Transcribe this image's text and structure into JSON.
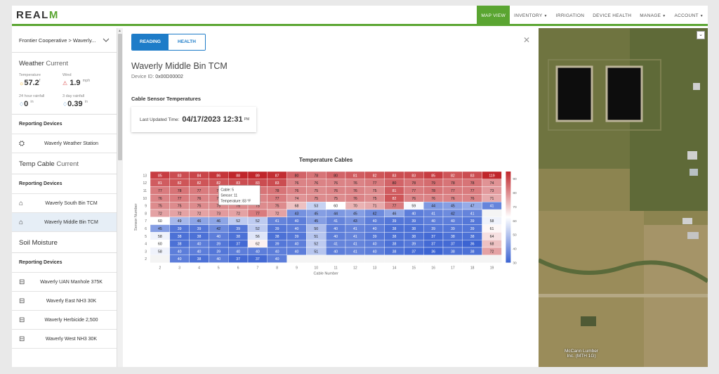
{
  "brand": {
    "logo_main": "REAL",
    "logo_accent": "M"
  },
  "nav": [
    {
      "label": "MAP VIEW",
      "active": true,
      "caret": false
    },
    {
      "label": "INVENTORY",
      "active": false,
      "caret": true
    },
    {
      "label": "IRRIGATION",
      "active": false,
      "caret": false
    },
    {
      "label": "DEVICE HEALTH",
      "active": false,
      "caret": false
    },
    {
      "label": "MANAGE",
      "active": false,
      "caret": true
    },
    {
      "label": "ACCOUNT",
      "active": false,
      "caret": true
    }
  ],
  "sidebar": {
    "breadcrumb": "Frontier Cooperative > Waverly...",
    "weather": {
      "title": "Weather",
      "title_suffix": "Current",
      "temperature_label": "Temperature",
      "temperature_value": "57.2",
      "temperature_unit": "f",
      "wind_label": "Wind",
      "wind_value": "1.9",
      "wind_unit": "mph",
      "rain24_label": "24 hour rainfall",
      "rain24_value": "0",
      "rain24_unit": "in",
      "rain3d_label": "3 day rainfall",
      "rain3d_value": "0.39",
      "rain3d_unit": "in"
    },
    "reporting_label_1": "Reporting Devices",
    "weather_devices": [
      {
        "label": "Waverly Weather Station"
      }
    ],
    "tempcable": {
      "title": "Temp Cable",
      "title_suffix": "Current"
    },
    "reporting_label_2": "Reporting Devices",
    "tc_devices": [
      {
        "label": "Waverly South Bin TCM",
        "selected": false
      },
      {
        "label": "Waverly Middle Bin TCM",
        "selected": true
      }
    ],
    "soil": {
      "title": "Soil Moisture"
    },
    "reporting_label_3": "Reporting Devices",
    "soil_devices": [
      {
        "label": "Waverly UAN Manhole 375K"
      },
      {
        "label": "Waverly East NH3 30K"
      },
      {
        "label": "Waverly Herbicide 2,500"
      },
      {
        "label": "Waverly West NH3 30K"
      }
    ]
  },
  "modal": {
    "tabs": [
      {
        "label": "READING",
        "active": true
      },
      {
        "label": "HEALTH",
        "active": false
      }
    ],
    "title": "Waverly Middle Bin TCM",
    "device_id_label": "Device ID:",
    "device_id": "0x00D00002",
    "section_title": "Cable Sensor Temperatures",
    "updated_label": "Last Updated Time:",
    "updated_value": "04/17/2023 12:31",
    "updated_ampm": "PM"
  },
  "map": {
    "label_line1": "McCann Lumber",
    "label_line2": "Inc. (MTH 1G)"
  },
  "tooltip": {
    "line1": "Cable: 5",
    "line2": "Sensor: 11",
    "line3": "Temperature: 83 °F"
  },
  "chart_data": {
    "type": "heatmap",
    "title": "Temperature Cables",
    "xlabel": "Cable Number",
    "ylabel": "Sensor Number",
    "x": [
      2,
      3,
      4,
      5,
      6,
      7,
      8,
      9,
      10,
      11,
      12,
      13,
      14,
      15,
      16,
      17,
      18,
      19
    ],
    "y": [
      13,
      12,
      11,
      10,
      9,
      8,
      7,
      6,
      5,
      4,
      3,
      2
    ],
    "values": [
      [
        85,
        83,
        84,
        86,
        88,
        89,
        87,
        80,
        78,
        80,
        81,
        82,
        83,
        83,
        85,
        82,
        83,
        119
      ],
      [
        81,
        82,
        82,
        82,
        83,
        83,
        83,
        76,
        76,
        76,
        76,
        77,
        80,
        78,
        79,
        78,
        78,
        74
      ],
      [
        77,
        78,
        77,
        77,
        78,
        78,
        78,
        76,
        75,
        76,
        76,
        75,
        81,
        77,
        78,
        77,
        77,
        73
      ],
      [
        76,
        77,
        76,
        76,
        76,
        76,
        77,
        74,
        75,
        75,
        76,
        75,
        82,
        76,
        76,
        76,
        76,
        71
      ],
      [
        75,
        75,
        75,
        75,
        75,
        75,
        75,
        68,
        53,
        60,
        70,
        71,
        77,
        59,
        44,
        45,
        47,
        41
      ],
      [
        72,
        72,
        72,
        73,
        72,
        77,
        72,
        43,
        45,
        44,
        45,
        42,
        46,
        40,
        41,
        42,
        41,
        null
      ],
      [
        60,
        49,
        46,
        46,
        52,
        52,
        41,
        40,
        45,
        41,
        43,
        40,
        39,
        39,
        40,
        40,
        39,
        58
      ],
      [
        45,
        39,
        39,
        42,
        39,
        52,
        39,
        40,
        50,
        40,
        41,
        40,
        38,
        38,
        39,
        39,
        39,
        61
      ],
      [
        58,
        38,
        38,
        40,
        38,
        56,
        38,
        39,
        51,
        40,
        41,
        39,
        38,
        38,
        37,
        38,
        38,
        64
      ],
      [
        60,
        38,
        40,
        39,
        37,
        62,
        39,
        40,
        52,
        41,
        41,
        40,
        38,
        39,
        37,
        37,
        36,
        68
      ],
      [
        58,
        40,
        40,
        39,
        40,
        40,
        40,
        40,
        51,
        40,
        41,
        40,
        38,
        37,
        36,
        38,
        38,
        72
      ],
      [
        null,
        40,
        38,
        40,
        37,
        37,
        40,
        null,
        null,
        null,
        null,
        null,
        null,
        null,
        null,
        null,
        null,
        null
      ]
    ],
    "colorbar_ticks": [
      90,
      80,
      70,
      60,
      50,
      40,
      30
    ],
    "colorbar_range": [
      30,
      95
    ],
    "colors": {
      "high": "#c0262b",
      "mid": "#ffffff",
      "low": "#3c64d2"
    }
  }
}
